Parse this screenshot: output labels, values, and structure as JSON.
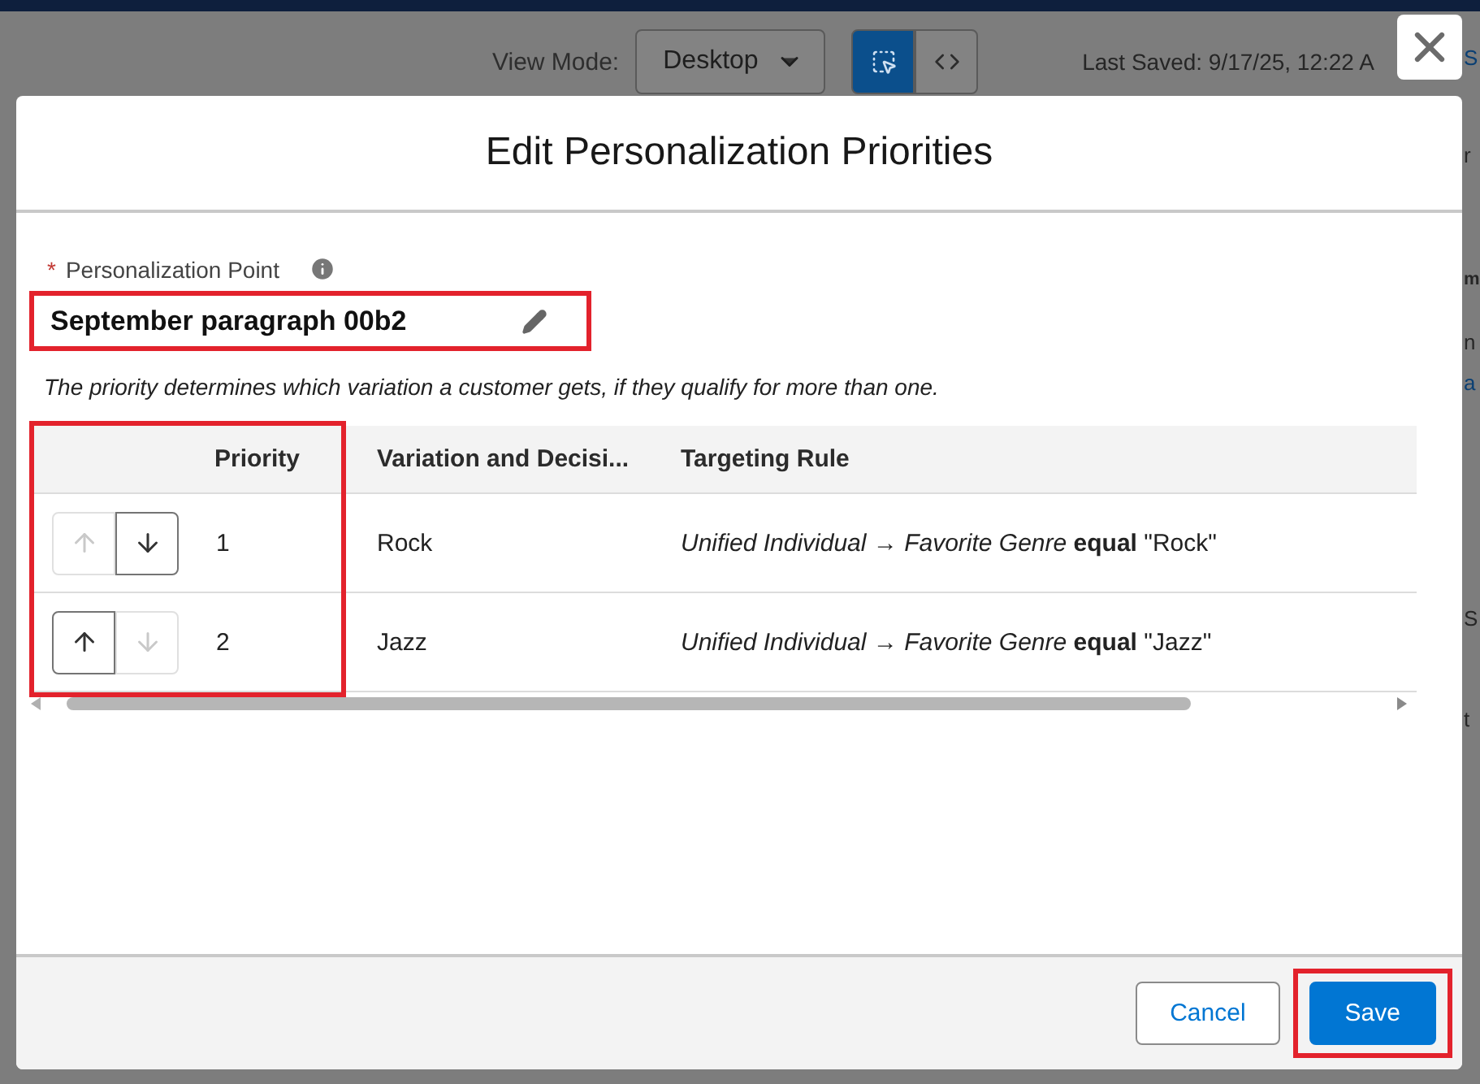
{
  "background": {
    "view_mode_label": "View Mode:",
    "view_mode_value": "Desktop",
    "toggle": [
      {
        "kind": "design",
        "selected": true
      },
      {
        "kind": "code",
        "selected": false
      }
    ],
    "last_saved": "Last Saved: 9/17/25, 12:22 A",
    "edge_fragments": [
      {
        "text": "S",
        "kind": "link"
      },
      {
        "text": "r",
        "kind": "plain"
      },
      {
        "text": "m",
        "kind": "bold"
      },
      {
        "text": "n",
        "kind": "plain"
      },
      {
        "text": "a",
        "kind": "link"
      },
      {
        "text": "S",
        "kind": "plain"
      },
      {
        "text": "t",
        "kind": "plain"
      }
    ]
  },
  "modal": {
    "title": "Edit Personalization Priorities",
    "field": {
      "label": "Personalization Point",
      "required": true,
      "required_mark": "*",
      "value": "September paragraph 00b2"
    },
    "hint": "The priority determines which variation a customer gets, if they qualify for more than one.",
    "table": {
      "columns": [
        "Priority",
        "Variation and Decisi...",
        "Targeting Rule"
      ],
      "rows": [
        {
          "up_disabled": true,
          "down_disabled": false,
          "priority": "1",
          "variation": "Rock",
          "rule": "*Unified Individual → Favorite Genre* **equal** \"Rock\""
        },
        {
          "up_disabled": false,
          "down_disabled": true,
          "priority": "2",
          "variation": "Jazz",
          "rule": "*Unified Individual → Favorite Genre* **equal** \"Jazz\""
        }
      ]
    },
    "buttons": [
      {
        "label": "Cancel",
        "kind": "neutral"
      },
      {
        "label": "Save",
        "kind": "brand"
      }
    ]
  }
}
